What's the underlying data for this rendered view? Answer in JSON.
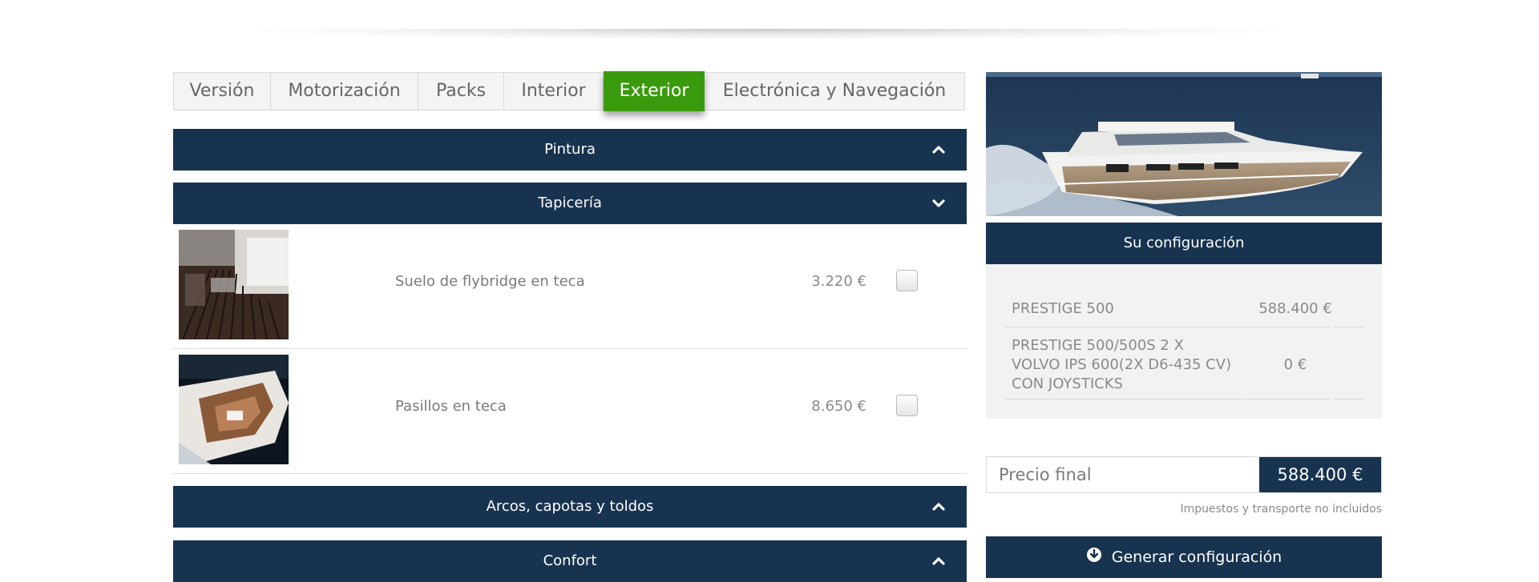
{
  "tabs": [
    {
      "label": "Versión"
    },
    {
      "label": "Motorización"
    },
    {
      "label": "Packs"
    },
    {
      "label": "Interior"
    },
    {
      "label": "Exterior",
      "active": true
    },
    {
      "label": "Electrónica y Navegación"
    }
  ],
  "sections": {
    "pintura": {
      "title": "Pintura",
      "state": "collapsed",
      "icon": "chevron-up-icon"
    },
    "tapiceria": {
      "title": "Tapicería",
      "state": "expanded",
      "icon": "chevron-down-icon",
      "options": [
        {
          "name": "Suelo de flybridge en teca",
          "price": "3.220 €",
          "checked": false,
          "image": "teak-flybridge-floor-photo"
        },
        {
          "name": "Pasillos en teca",
          "price": "8.650 €",
          "checked": false,
          "image": "teak-walkways-boat-photo"
        }
      ]
    },
    "arcos": {
      "title": "Arcos, capotas y toldos",
      "state": "collapsed",
      "icon": "chevron-up-icon"
    },
    "confort": {
      "title": "Confort",
      "state": "collapsed",
      "icon": "chevron-up-icon"
    }
  },
  "sidebar": {
    "photo": "yacht-photo",
    "config_title": "Su configuración",
    "config_items": [
      {
        "name": "PRESTIGE 500",
        "price": "588.400 €"
      },
      {
        "name": "PRESTIGE 500/500S 2 X VOLVO IPS 600(2X D6-435 CV) CON JOYSTICKS",
        "name_lines": [
          "PRESTIGE 500/500S 2 X",
          "VOLVO IPS 600(2X D6-435 CV)",
          "CON JOYSTICKS"
        ],
        "price": "0 €"
      }
    ],
    "final_label": "Precio final",
    "final_price": "588.400 €",
    "tax_note": "Impuestos y transporte no incluidos",
    "generate_label": "Generar configuración",
    "generate_icon": "download-icon"
  },
  "colors": {
    "navy": "#17334f",
    "green": "#3a9a0d"
  }
}
